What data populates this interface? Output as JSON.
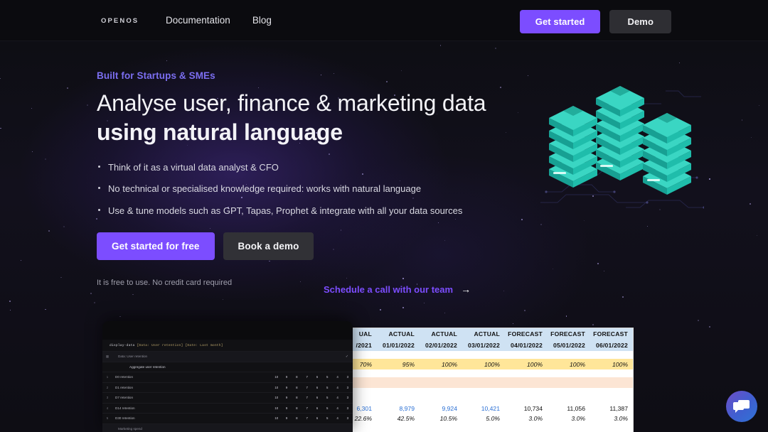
{
  "nav": {
    "logo": "OPENOS",
    "links": [
      {
        "label": "Documentation"
      },
      {
        "label": "Blog"
      }
    ],
    "get_started_label": "Get started",
    "demo_label": "Demo"
  },
  "hero": {
    "eyebrow": "Built for Startups & SMEs",
    "title_light": "Analyse user, finance & marketing data",
    "title_bold": "using natural language",
    "bullets": [
      "Think of it as a virtual data analyst & CFO",
      "No technical or specialised knowledge required: works with natural language",
      "Use & tune models such as GPT, Tapas, Prophet & integrate with all your data sources"
    ],
    "cta_primary": "Get started for free",
    "cta_secondary": "Book a demo",
    "disclaimer": "It is free to use. No credit card required",
    "schedule_link": "Schedule a call with our team",
    "schedule_arrow": "→"
  },
  "console": {
    "command": "display-data",
    "command_args": "[Data: User retention] [Date: Last month]",
    "header_label": "Data: User retention",
    "header_check": "✓",
    "rows": [
      {
        "idx": "",
        "label": "Aggregate user retention",
        "nums": []
      },
      {
        "idx": "1",
        "label": "D0 retention",
        "nums": [
          "10",
          "9",
          "8",
          "7",
          "6",
          "5",
          "4",
          "3"
        ]
      },
      {
        "idx": "2",
        "label": "D1 retention",
        "nums": [
          "10",
          "9",
          "8",
          "7",
          "6",
          "5",
          "4",
          "3"
        ]
      },
      {
        "idx": "3",
        "label": "D7 retention",
        "nums": [
          "10",
          "9",
          "8",
          "7",
          "6",
          "5",
          "4",
          "3"
        ]
      },
      {
        "idx": "4",
        "label": "D14 retention",
        "nums": [
          "10",
          "9",
          "8",
          "7",
          "6",
          "5",
          "4",
          "3"
        ]
      },
      {
        "idx": "5",
        "label": "D30 retention",
        "nums": [
          "10",
          "9",
          "8",
          "7",
          "6",
          "5",
          "4",
          "3"
        ]
      },
      {
        "idx": "",
        "label": "Marketing spend",
        "nums": []
      }
    ]
  },
  "sheet": {
    "col_types": [
      "UAL",
      "ACTUAL",
      "ACTUAL",
      "ACTUAL",
      "ACTUAL",
      "FORECAST",
      "FORECAST",
      "FORECAST"
    ],
    "col_dates": [
      "/2021",
      "01/01/2022",
      "02/01/2022",
      "03/01/2022",
      "04/01/2022",
      "05/01/2022",
      "06/01/2022"
    ],
    "row_percent_yellow": [
      "70%",
      "95%",
      "100%",
      "100%",
      "100%",
      "100%",
      "100%"
    ],
    "row_numbers": [
      "6,301",
      "8,979",
      "9,924",
      "10,421",
      "10,734",
      "11,056",
      "11,387"
    ],
    "row_numbers_actual_count": 4,
    "row_growth": [
      "22.6%",
      "42.5%",
      "10.5%",
      "5.0%",
      "3.0%",
      "3.0%",
      "3.0%"
    ]
  },
  "chat": {
    "icon": "chat-bubbles"
  },
  "colors": {
    "accent_purple": "#7c4dff",
    "eyebrow_purple": "#7b6ef0",
    "server_teal": "#2ec4b6",
    "sheet_header_blue": "#cfe2f3",
    "sheet_yellow": "#ffe699",
    "sheet_peach": "#fce5d4",
    "actual_blue": "#2a6fd4"
  }
}
